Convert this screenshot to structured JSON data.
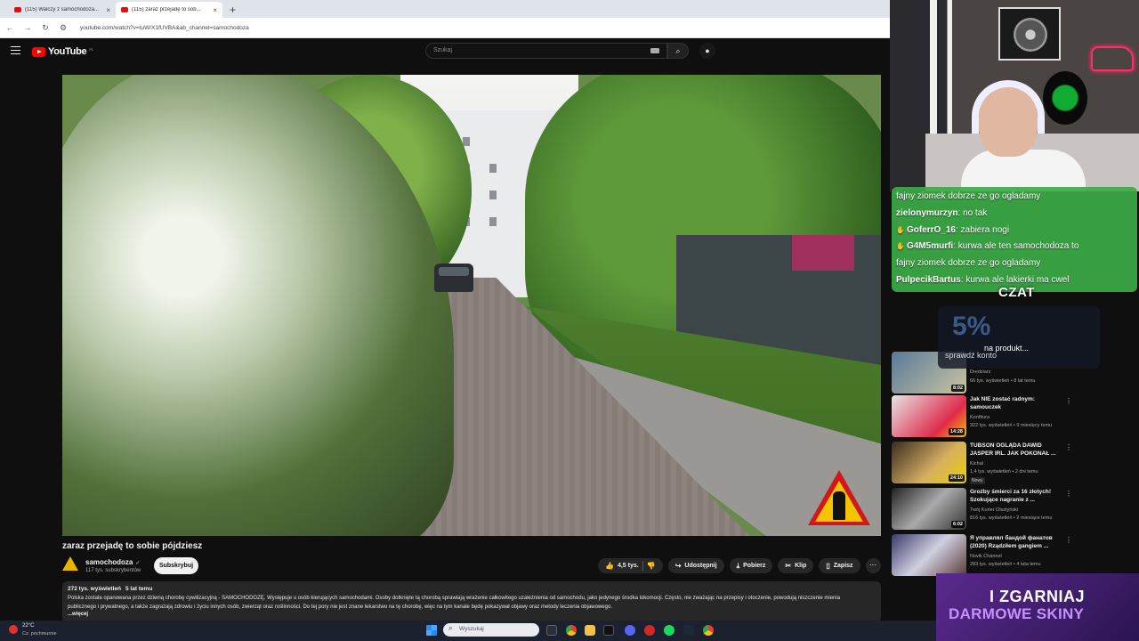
{
  "browser": {
    "tabs": [
      {
        "title": "(115) Walczy z samochodoza..."
      },
      {
        "title": "(115) zaraz przejadę to sob..."
      }
    ],
    "url": "youtube.com/watch?v=tuW/X1fUVBA&ab_channel=samochodoza"
  },
  "header": {
    "logo_text": "YouTube",
    "logo_suffix": "PL",
    "search_placeholder": "Szukaj"
  },
  "video": {
    "title": "zaraz przejadę to sobie pójdziesz",
    "channel": "samochodoza",
    "subscribers": "117 tys. subskrybentów",
    "subscribe_label": "Subskrybuj",
    "likes": "4,5 tys.",
    "share_label": "Udostępnij",
    "download_label": "Pobierz",
    "clip_label": "Klip",
    "save_label": "Zapisz",
    "views": "272 tys. wyświetleń",
    "age": "5 lat temu",
    "description": "Polska została opanowana przez dziwną chorobę cywilizacyjną - SAMOCHODOZĘ. Występuje u osób kierujących samochodami. Osoby dotknięte tą chorobą sprawiają wrażenie całkowitego uzależnienia od samochodu, jako jedynego środka lokomocji. Często, nie zważając na przepisy i otoczenie, powodują niszczenie mienia publicznego i prywatnego, a także zagrażają zdrowiu i życiu innych osób, zwierząt oraz roślinności. Do tej pory nie jest znane lekarstwo na tę chorobę, więc na tym kanale będę pokazywał objawy oraz metody leczenia objawowego.",
    "more_label": "...więcej"
  },
  "chat": {
    "lines": [
      {
        "user": "",
        "text": "fajny ziomek dobrze ze go ogladamy"
      },
      {
        "user": "zielonymurzyn",
        "text": ": no tak"
      },
      {
        "user": "GoferrO_16",
        "text": ": zabiera nogi"
      },
      {
        "user": "G4M5murfi",
        "text": ": kurwa ale ten samochodoza to"
      },
      {
        "user": "",
        "text": "fajny ziomek dobrze ze go ogladamy"
      },
      {
        "user": "PulpecikBartus",
        "text": ": kurwa ale lakierki ma cwel"
      }
    ],
    "label": "CZAT"
  },
  "promo": {
    "big": "5%",
    "sub": "na produkt...",
    "sub2": "sprawdź konto"
  },
  "recommendations": [
    {
      "title": "",
      "channel": "Dredziarz",
      "meta": "66 tys. wyświetleń • 8 lat temu",
      "duration": "8:02",
      "badge": ""
    },
    {
      "title": "Jak NIE zostać radnym: samouczek",
      "channel": "Konfitura",
      "meta": "322 tys. wyświetleń • 9 miesięcy temu",
      "duration": "14:28",
      "badge": ""
    },
    {
      "title": "TUBSON OGLĄDA DAWID JASPER IRL. JAK POKONAŁ ...",
      "channel": "Kichal",
      "meta": "1,4 tys. wyświetleń • 2 dni temu",
      "duration": "24:10",
      "badge": "Nowy"
    },
    {
      "title": "Groźby śmierci za 16 złotych! Szokujące nagranie z ...",
      "channel": "Twój Kurier Olsztyński",
      "meta": "816 tys. wyświetleń • 2 miesiące temu",
      "duration": "6:02",
      "badge": ""
    },
    {
      "title": "Я управлял бандой фанатов (2020) Rządziłem gangiem ...",
      "channel": "Novik Channel",
      "meta": "283 tys. wyświetleń • 4 lata temu",
      "duration": "",
      "badge": ""
    }
  ],
  "banner": {
    "line1": "I ZGARNIAJ",
    "line2": "DARMOWE SKINY"
  },
  "taskbar": {
    "temp": "22°C",
    "weather": "Cz. pochmurnie",
    "search_placeholder": "Wyszukaj"
  },
  "colors": {
    "youtube_red": "#ff0000",
    "chat_green": "#3caa46",
    "banner_purple": "#5b2a8e"
  }
}
